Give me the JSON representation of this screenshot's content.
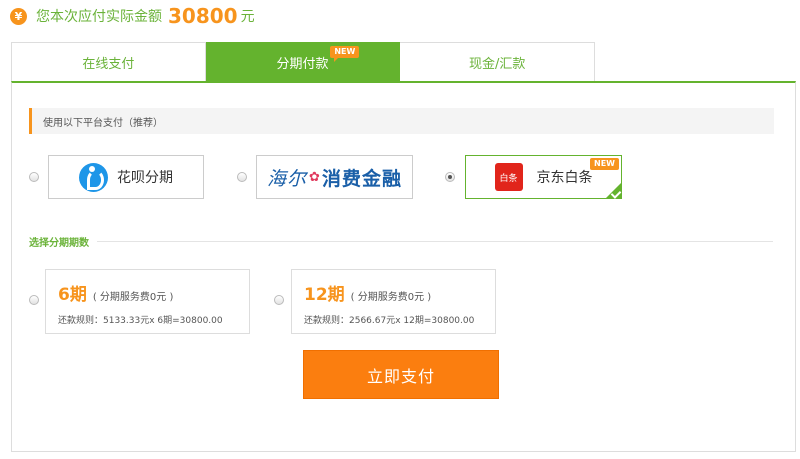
{
  "header": {
    "currency_icon": "yuan-icon",
    "label": "您本次应付实际金额",
    "amount": "30800",
    "unit": "元"
  },
  "tabs": [
    {
      "label": "在线支付",
      "active": false
    },
    {
      "label": "分期付款",
      "active": true,
      "badge": "NEW"
    },
    {
      "label": "现金/汇款",
      "active": false
    }
  ],
  "platform_section": {
    "title": "使用以下平台支付（推荐）"
  },
  "platforms": [
    {
      "name": "花呗分期",
      "logo": "huabei-logo-icon",
      "selected": false
    },
    {
      "name": "海尔消费金融",
      "logo_text_a": "海尔",
      "logo_text_b": "消费金融",
      "selected": false
    },
    {
      "name": "京东白条",
      "logo_text": "白条",
      "badge": "NEW",
      "selected": true
    }
  ],
  "installment_section": {
    "title": "选择分期期数"
  },
  "installments": [
    {
      "period": "6期",
      "fee": "( 分期服务费0元 )",
      "rule": "还款规则：5133.33元x 6期=30800.00"
    },
    {
      "period": "12期",
      "fee": "( 分期服务费0元 )",
      "rule": "还款规则：2566.67元x 12期=30800.00"
    }
  ],
  "pay_button": {
    "label": "立即支付"
  },
  "colors": {
    "accent_green": "#64b32e",
    "accent_orange": "#f7941d",
    "button_orange": "#fb7e0f"
  }
}
